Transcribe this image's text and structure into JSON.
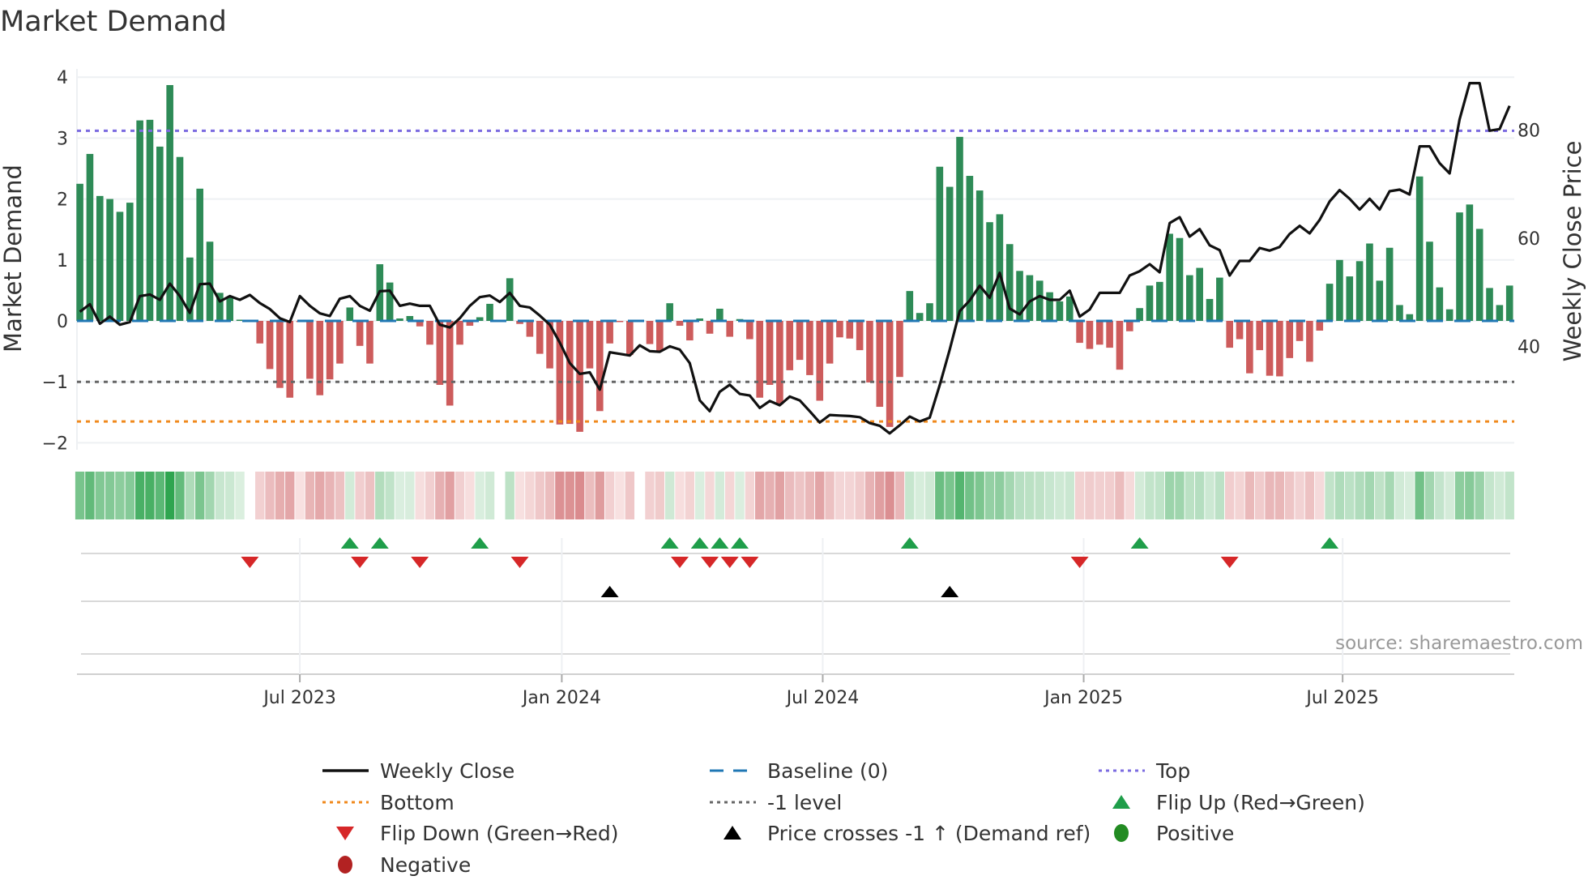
{
  "chart_data": {
    "type": "bar+line",
    "title": "Market Demand",
    "ylabel": "Market Demand",
    "y2label": "Weekly Close Price",
    "ylim": [
      -2.2,
      4.2
    ],
    "y2lim": [
      20,
      93
    ],
    "yticks": [
      "4",
      "3",
      "2",
      "1",
      "0",
      "−1",
      "−2"
    ],
    "ytick_values": [
      4,
      3,
      2,
      1,
      0,
      -1,
      -2
    ],
    "y2ticks": [
      "80",
      "60",
      "40"
    ],
    "y2tick_values": [
      80,
      60,
      40
    ],
    "x_frequency": "weekly",
    "xticks": [
      {
        "label": "Jul 2023",
        "week_index": 22
      },
      {
        "label": "Jan 2024",
        "week_index": 48.2
      },
      {
        "label": "Jul 2024",
        "week_index": 74.3
      },
      {
        "label": "Jan 2025",
        "week_index": 100.4
      },
      {
        "label": "Jul 2025",
        "week_index": 126.3
      }
    ],
    "levels": {
      "baseline": 0,
      "top": 3.12,
      "bottom": -1.65,
      "minus_one": -1
    },
    "demand": [
      2.25,
      2.74,
      2.05,
      2.0,
      1.79,
      1.94,
      3.29,
      3.3,
      2.86,
      3.87,
      2.69,
      1.04,
      2.17,
      1.3,
      0.46,
      0.38,
      0.02,
      -0.01,
      -0.37,
      -0.79,
      -1.1,
      -1.26,
      -0.02,
      -0.95,
      -1.22,
      -0.96,
      -0.7,
      0.22,
      -0.41,
      -0.7,
      0.93,
      0.63,
      0.04,
      0.08,
      -0.09,
      -0.39,
      -1.05,
      -1.39,
      -0.39,
      -0.08,
      0.06,
      0.28,
      0.01,
      0.7,
      -0.05,
      -0.26,
      -0.54,
      -0.78,
      -1.7,
      -1.69,
      -1.82,
      -0.78,
      -1.48,
      -0.37,
      -0.02,
      -0.56,
      -0.01,
      -0.38,
      -0.49,
      0.29,
      -0.08,
      -0.32,
      0.04,
      -0.21,
      0.2,
      -0.26,
      0.03,
      -0.3,
      -1.26,
      -1.05,
      -1.37,
      -0.81,
      -0.64,
      -0.89,
      -1.31,
      -0.7,
      -0.27,
      -0.29,
      -0.48,
      -1.01,
      -1.41,
      -1.74,
      -0.92,
      0.49,
      0.13,
      0.29,
      2.53,
      2.2,
      3.02,
      2.38,
      2.14,
      1.62,
      1.75,
      1.26,
      0.82,
      0.75,
      0.66,
      0.47,
      0.32,
      0.4,
      -0.36,
      -0.46,
      -0.39,
      -0.44,
      -0.8,
      -0.17,
      0.21,
      0.58,
      0.64,
      1.43,
      1.36,
      0.75,
      0.87,
      0.36,
      0.71,
      -0.44,
      -0.3,
      -0.86,
      -0.48,
      -0.9,
      -0.91,
      -0.61,
      -0.33,
      -0.67,
      -0.16,
      0.61,
      1.0,
      0.73,
      0.98,
      1.27,
      0.66,
      1.2,
      0.26,
      0.11,
      2.37,
      1.3,
      0.55,
      0.19,
      1.78,
      1.91,
      1.51,
      0.54,
      0.26,
      0.58
    ],
    "weekly_close": [
      46.4,
      47.8,
      44.2,
      45.5,
      44.0,
      44.5,
      49.3,
      49.6,
      48.6,
      51.6,
      49.3,
      46.2,
      51.5,
      51.6,
      48.3,
      49.3,
      48.6,
      49.5,
      48.0,
      46.9,
      45.2,
      44.5,
      49.3,
      47.5,
      46.1,
      45.6,
      48.8,
      49.3,
      47.5,
      46.6,
      50.2,
      50.3,
      47.5,
      47.9,
      47.5,
      47.5,
      44.0,
      43.5,
      45.2,
      47.5,
      49.1,
      49.4,
      48.2,
      49.9,
      47.5,
      47.2,
      45.7,
      44.0,
      40.7,
      36.9,
      34.9,
      35.2,
      32.0,
      38.9,
      38.6,
      38.3,
      40.2,
      39.1,
      39.0,
      40.0,
      39.4,
      36.9,
      30.0,
      28.0,
      31.6,
      32.9,
      31.2,
      30.9,
      28.6,
      29.9,
      29.1,
      30.7,
      30.0,
      28.0,
      25.9,
      27.3,
      27.2,
      27.1,
      26.9,
      25.8,
      25.3,
      23.9,
      25.4,
      27.0,
      26.1,
      26.8,
      32.8,
      39.4,
      46.5,
      48.5,
      51.2,
      49.0,
      53.6,
      47.0,
      45.9,
      48.3,
      49.3,
      48.6,
      48.6,
      50.3,
      45.5,
      46.8,
      49.9,
      49.9,
      49.9,
      53.1,
      53.9,
      55.2,
      53.7,
      62.8,
      63.9,
      60.3,
      61.7,
      58.7,
      57.8,
      53.1,
      55.8,
      55.8,
      58.2,
      57.7,
      58.4,
      60.8,
      62.3,
      60.9,
      63.4,
      66.8,
      68.9,
      67.3,
      65.3,
      67.3,
      65.3,
      68.7,
      69.0,
      68.1,
      77.0,
      77.0,
      73.9,
      72.0,
      82.0,
      88.7,
      88.7,
      79.9,
      80.2,
      84.5
    ],
    "flip_up_weeks": [
      27,
      30,
      40,
      59,
      62,
      64,
      66,
      83,
      106,
      125
    ],
    "flip_down_weeks": [
      17,
      28,
      34,
      44,
      60,
      63,
      65,
      67,
      100,
      115
    ],
    "price_cross_weeks": [
      53,
      87
    ],
    "legend_position": "bottom",
    "legend": [
      {
        "label": "Weekly Close",
        "kind": "line",
        "color": "#111111"
      },
      {
        "label": "Baseline (0)",
        "kind": "dash",
        "color": "#1f77b4"
      },
      {
        "label": "Top",
        "kind": "dot",
        "color": "#7b6be0"
      },
      {
        "label": "Bottom",
        "kind": "dot",
        "color": "#f0891c"
      },
      {
        "label": "-1 level",
        "kind": "dot",
        "color": "#666666"
      },
      {
        "label": "Flip Up (Red→Green)",
        "kind": "tri-up",
        "color": "#1f9e4a"
      },
      {
        "label": "Flip Down (Green→Red)",
        "kind": "tri-down",
        "color": "#d62728"
      },
      {
        "label": "Price crosses -1 ↑ (Demand ref)",
        "kind": "tri-up",
        "color": "#000000"
      },
      {
        "label": "Positive",
        "kind": "circle",
        "color": "#228b22"
      },
      {
        "label": "Negative",
        "kind": "circle",
        "color": "#b22222"
      }
    ],
    "colors": {
      "positive_bar": "#2e8b57",
      "negative_bar": "#cd5c5c",
      "grid": "#eef0f3"
    }
  },
  "source": "source: sharemaestro.com"
}
